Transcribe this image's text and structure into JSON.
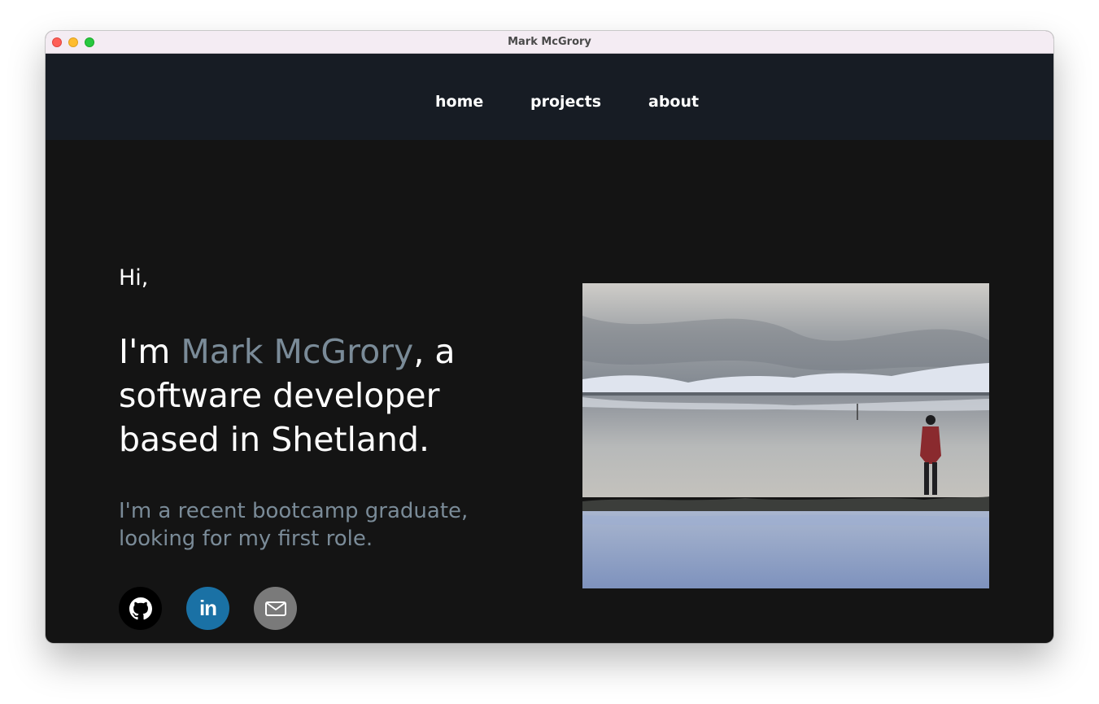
{
  "window": {
    "title": "Mark McGrory"
  },
  "nav": {
    "items": [
      {
        "label": "home"
      },
      {
        "label": "projects"
      },
      {
        "label": "about"
      }
    ]
  },
  "hero": {
    "greeting": "Hi,",
    "intro_prefix": "I'm ",
    "name": "Mark McGrory",
    "intro_suffix": ", a software developer based in Shetland.",
    "subtitle": "I'm a recent bootcamp graduate, looking for my first role.",
    "name_color": "#7a8b98"
  },
  "social": [
    {
      "icon": "github-icon",
      "color": "#000000"
    },
    {
      "icon": "linkedin-icon",
      "text": "in",
      "color": "#1a71a5"
    },
    {
      "icon": "mail-icon",
      "color": "#7a7a7a"
    }
  ]
}
